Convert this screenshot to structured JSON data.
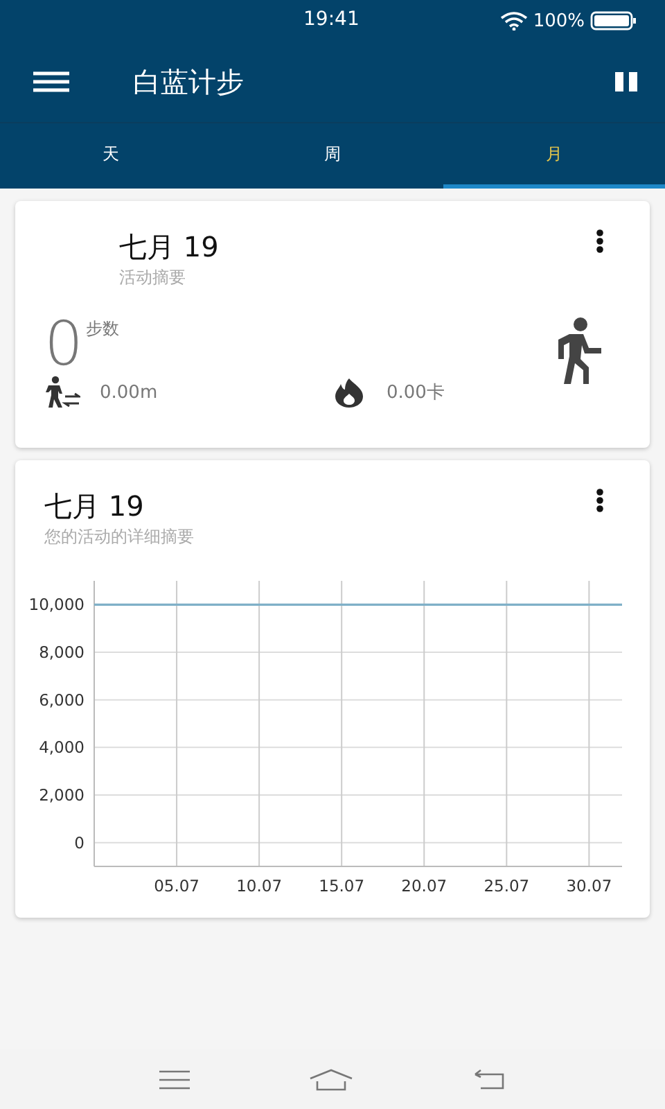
{
  "status_bar": {
    "time": "19:41",
    "battery": "100%"
  },
  "app_bar": {
    "title": "白蓝计步"
  },
  "tabs": [
    {
      "label": "天",
      "selected": false
    },
    {
      "label": "周",
      "selected": false
    },
    {
      "label": "月",
      "selected": true
    }
  ],
  "summary_card": {
    "title": "七月 19",
    "subtitle": "活动摘要",
    "steps": "0",
    "steps_label": "步数",
    "distance": "0.00m",
    "calories": "0.00卡"
  },
  "detail_card": {
    "title": "七月 19",
    "subtitle": "您的活动的详细摘要",
    "chart_data": {
      "type": "line",
      "grid": true,
      "ylim": [
        -1000,
        11000
      ],
      "categories": [
        null,
        null,
        null,
        null,
        "05.07",
        null,
        null,
        null,
        null,
        "10.07",
        null,
        null,
        null,
        null,
        "15.07",
        null,
        null,
        null,
        null,
        "20.07",
        null,
        null,
        null,
        null,
        "25.07",
        null,
        null,
        null,
        null,
        "30.07",
        null
      ],
      "yticks": [
        {
          "value": 0,
          "label": "0"
        },
        {
          "value": 2000,
          "label": "2,000"
        },
        {
          "value": 4000,
          "label": "4,000"
        },
        {
          "value": 6000,
          "label": "6,000"
        },
        {
          "value": 8000,
          "label": "8,000"
        },
        {
          "value": 10000,
          "label": "10,000"
        }
      ],
      "ref_lines": [
        {
          "axis": "y",
          "value": 10000
        }
      ]
    }
  }
}
